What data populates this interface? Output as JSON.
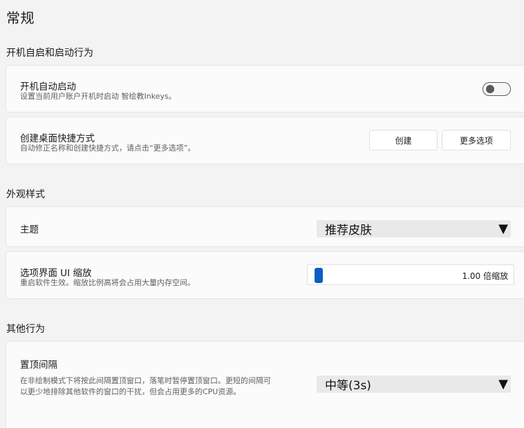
{
  "page": {
    "title": "常规"
  },
  "sections": {
    "startup": {
      "title": "开机自启和启动行为"
    },
    "appearance": {
      "title": "外观样式"
    },
    "other": {
      "title": "其他行为"
    }
  },
  "autostart": {
    "title": "开机自动启动",
    "desc": "设置当前用户账户开机时启动 智绘教Inkeys。",
    "enabled": false
  },
  "shortcut": {
    "title": "创建桌面快捷方式",
    "desc": "自动修正名称和创建快捷方式，请点击“更多选项”。",
    "create_label": "创建",
    "more_label": "更多选项"
  },
  "theme": {
    "title": "主题",
    "selected": "推荐皮肤",
    "arrow": "▼"
  },
  "ui_scale": {
    "title": "选项界面 UI 缩放",
    "desc": "重启软件生效。缩放比例高将会占用大量内存空间。",
    "value_label": "1.00 倍缩放",
    "fraction": 0.0
  },
  "topmost": {
    "title": "置顶间隔",
    "desc_line1": "在非绘制模式下将按此间隔置顶窗口，落笔时暂停置顶窗口。更短的间隔可",
    "desc_line2": "以更少地排除其他软件的窗口的干扰，但会占用更多的CPU资源。",
    "selected": "中等(3s)",
    "arrow": "▼"
  }
}
